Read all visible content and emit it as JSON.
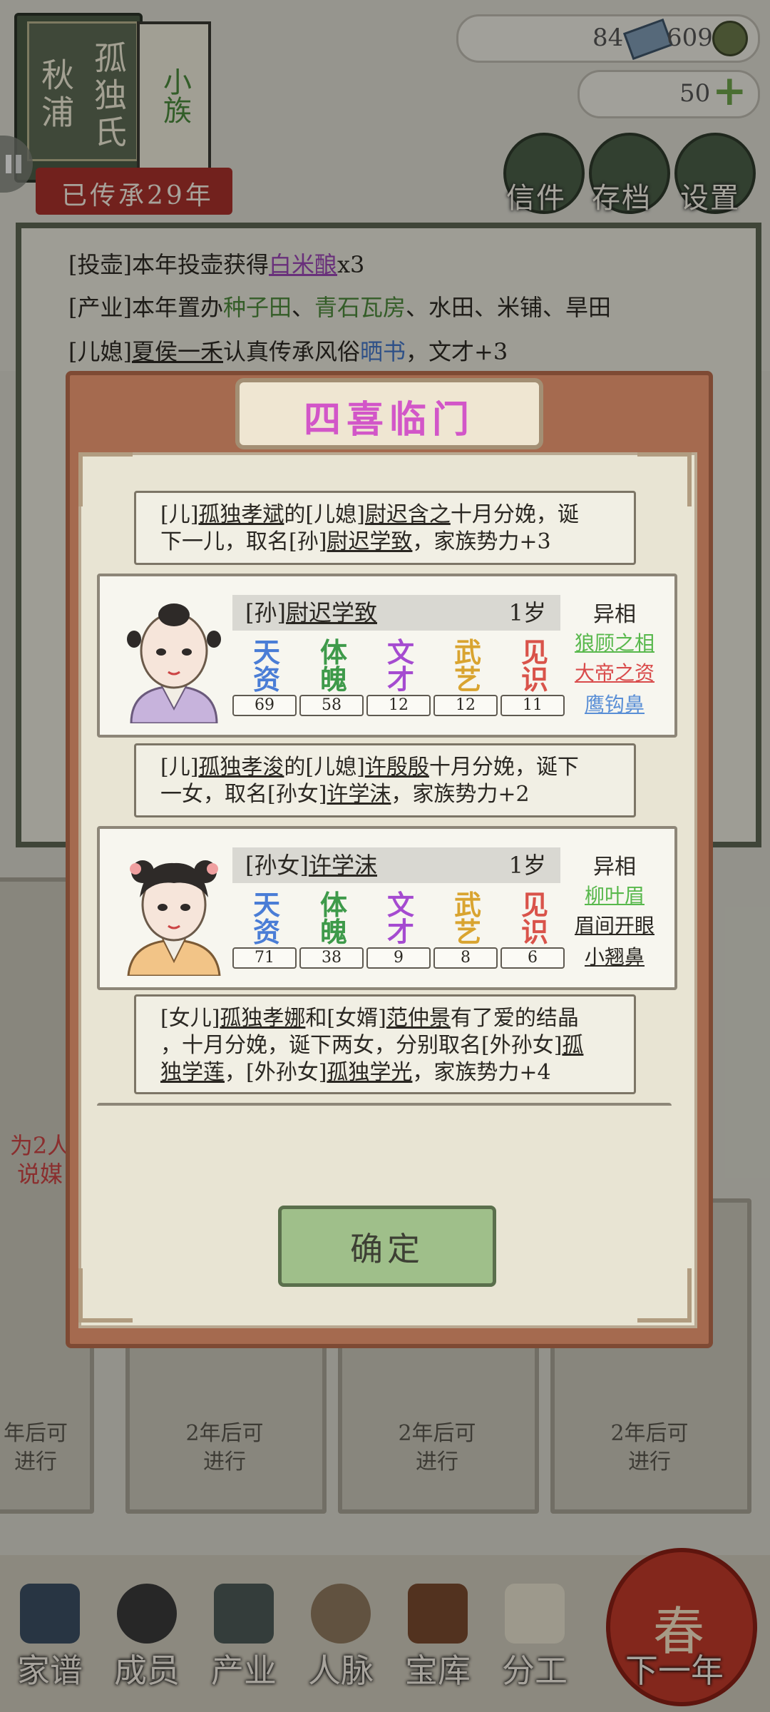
{
  "header": {
    "book_left": "秋浦",
    "book_right": "孤独氏",
    "side_book": "小族",
    "inherited_years": "已传承29年"
  },
  "resources": {
    "tickets": "84",
    "coins": "609",
    "gold": "50"
  },
  "top_buttons": [
    "信件",
    "存档",
    "设置"
  ],
  "log": [
    {
      "prefix": "[投壶]本年投壶获得",
      "item": "白米酿",
      "suffix": "x3"
    },
    {
      "prefix": "[产业]本年置办",
      "item1": "种子田",
      "sep1": "、",
      "item2": "青石瓦房",
      "rest": "、水田、米铺、旱田"
    },
    {
      "prefix": "[儿媳]",
      "name": "夏侯一禾",
      "middle": "认真传承风俗",
      "item": "晒书",
      "suffix": "，文才+3"
    }
  ],
  "modal": {
    "title": "四喜临门",
    "messages": [
      {
        "line1_parts": [
          "[儿]",
          "孤独孝斌",
          "的[儿媳]",
          "尉迟含之",
          "十月分娩，诞"
        ],
        "line2_parts": [
          "下一儿，取名[孙]",
          "尉迟学致",
          "，家族势力+3"
        ]
      },
      {
        "line1_parts": [
          "[儿]",
          "孤独孝浚",
          "的[儿媳]",
          "许殷殷",
          "十月分娩，诞下"
        ],
        "line2_parts": [
          "一女，取名[孙女]",
          "许学沫",
          "，家族势力+2"
        ]
      },
      {
        "line1_parts": [
          "[女儿]",
          "孤独孝娜",
          "和[女婿]",
          "范仲景",
          "有了爱的结晶"
        ],
        "line2_parts": [
          "，十月分娩，诞下两女，分别取名[外孙女]",
          "孤"
        ],
        "line3_parts": [
          "独学莲",
          "，[外孙女]",
          "孤独学光",
          "，家族势力+4"
        ]
      }
    ],
    "children": [
      {
        "title_prefix": "[孙]",
        "name": "尉迟学致",
        "age": "1岁",
        "attrs": [
          {
            "label": "天资",
            "value": "69",
            "color": "#4a7dd6"
          },
          {
            "label": "体魄",
            "value": "58",
            "color": "#3e9a4a"
          },
          {
            "label": "文才",
            "value": "12",
            "color": "#a54bd0"
          },
          {
            "label": "武艺",
            "value": "12",
            "color": "#d9a430"
          },
          {
            "label": "见识",
            "value": "11",
            "color": "#d9534a"
          }
        ],
        "trait_title": "异相",
        "traits": [
          {
            "text": "狼顾之相",
            "color": "#58b84c"
          },
          {
            "text": "大帝之资",
            "color": "#d94b4b"
          },
          {
            "text": "鹰钩鼻",
            "color": "#5a8fd6"
          }
        ]
      },
      {
        "title_prefix": "[孙女]",
        "name": "许学沫",
        "age": "1岁",
        "attrs": [
          {
            "label": "天资",
            "value": "71",
            "color": "#4a7dd6"
          },
          {
            "label": "体魄",
            "value": "38",
            "color": "#3e9a4a"
          },
          {
            "label": "文才",
            "value": "9",
            "color": "#a54bd0"
          },
          {
            "label": "武艺",
            "value": "8",
            "color": "#d9a430"
          },
          {
            "label": "见识",
            "value": "6",
            "color": "#d9534a"
          }
        ],
        "trait_title": "异相",
        "traits": [
          {
            "text": "柳叶眉",
            "color": "#58b84c"
          },
          {
            "text": "眉间开眼",
            "color": "#2a2722"
          },
          {
            "text": "小翘鼻",
            "color": "#2a2722"
          }
        ]
      }
    ],
    "confirm_label": "确定"
  },
  "background": {
    "left_side_text1": "为2人",
    "left_side_text2": "说媒",
    "cards": [
      "年后可\n进行",
      "2年后可\n进行",
      "2年后可\n进行",
      "2年后可\n进行"
    ]
  },
  "nav": [
    "家谱",
    "成员",
    "产业",
    "人脉",
    "宝库",
    "分工",
    "下一年"
  ],
  "lantern_char": "春"
}
